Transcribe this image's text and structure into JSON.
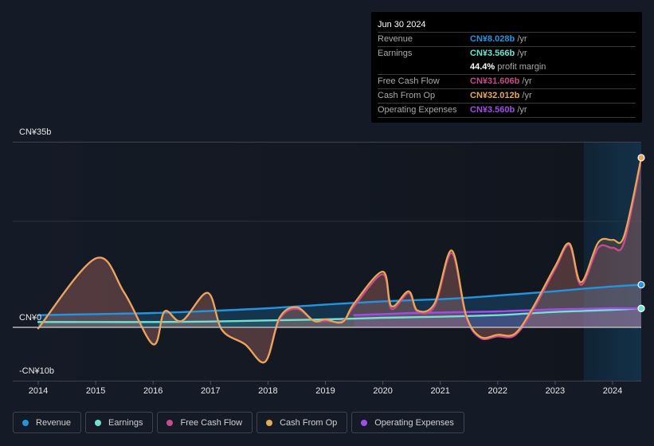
{
  "tooltip": {
    "date": "Jun 30 2024",
    "rows": [
      {
        "label": "Revenue",
        "value": "CN¥8.028b",
        "unit": " /yr",
        "color": "#2394df"
      },
      {
        "label": "Earnings",
        "value": "CN¥3.566b",
        "unit": " /yr",
        "color": "#6fe3d0"
      },
      {
        "label": "",
        "value": "44.4%",
        "unit": " profit margin",
        "color": "#ffffff"
      },
      {
        "label": "Free Cash Flow",
        "value": "CN¥31.606b",
        "unit": " /yr",
        "color": "#c84b8b"
      },
      {
        "label": "Cash From Op",
        "value": "CN¥32.012b",
        "unit": " /yr",
        "color": "#e8a956"
      },
      {
        "label": "Operating Expenses",
        "value": "CN¥3.560b",
        "unit": " /yr",
        "color": "#a24de8"
      }
    ]
  },
  "legend": [
    {
      "label": "Revenue",
      "color": "#2394df"
    },
    {
      "label": "Earnings",
      "color": "#6fe3d0"
    },
    {
      "label": "Free Cash Flow",
      "color": "#c84b8b"
    },
    {
      "label": "Cash From Op",
      "color": "#e8a956"
    },
    {
      "label": "Operating Expenses",
      "color": "#a24de8"
    }
  ],
  "chart_data": {
    "type": "line",
    "title": "",
    "xlabel": "",
    "ylabel": "",
    "y_tick_labels": [
      "CN¥35b",
      "CN¥0",
      "-CN¥10b"
    ],
    "y_ticks": [
      35,
      0,
      -10
    ],
    "ylim": [
      -10,
      35
    ],
    "x_tick_labels": [
      "2014",
      "2015",
      "2016",
      "2017",
      "2018",
      "2019",
      "2020",
      "2021",
      "2022",
      "2023",
      "2024"
    ],
    "xlim": [
      2013.85,
      2024.5
    ],
    "grid": true,
    "legend_position": "bottom",
    "highlight_range": [
      2023.5,
      2024.5
    ],
    "series": [
      {
        "name": "Revenue",
        "color": "#2394df",
        "x": [
          2014.0,
          2015.0,
          2016.0,
          2017.0,
          2018.0,
          2019.0,
          2020.0,
          2021.0,
          2021.5,
          2022.0,
          2022.5,
          2023.0,
          2023.5,
          2024.0,
          2024.5
        ],
        "values": [
          2.3,
          2.5,
          2.7,
          3.1,
          3.6,
          4.3,
          4.9,
          5.3,
          5.6,
          6.0,
          6.4,
          6.8,
          7.3,
          7.7,
          8.03
        ]
      },
      {
        "name": "Earnings",
        "color": "#6fe3d0",
        "x": [
          2014.0,
          2015.0,
          2016.0,
          2017.0,
          2018.0,
          2019.0,
          2020.0,
          2021.0,
          2022.0,
          2022.5,
          2023.0,
          2023.5,
          2024.0,
          2024.5
        ],
        "values": [
          1.0,
          1.0,
          1.0,
          1.1,
          1.3,
          1.5,
          1.8,
          2.0,
          2.3,
          2.6,
          2.9,
          3.1,
          3.3,
          3.57
        ]
      },
      {
        "name": "Free Cash Flow",
        "color": "#c84b8b",
        "x": [
          2014.0,
          2015.0,
          2015.5,
          2016.0,
          2016.2,
          2016.5,
          2016.95,
          2017.2,
          2017.6,
          2017.95,
          2018.2,
          2018.5,
          2018.8,
          2019.0,
          2019.3,
          2019.5,
          2020.0,
          2020.15,
          2020.45,
          2020.6,
          2020.9,
          2021.2,
          2021.45,
          2021.7,
          2022.0,
          2022.3,
          2022.6,
          2023.0,
          2023.25,
          2023.45,
          2023.75,
          2024.0,
          2024.2,
          2024.5
        ],
        "values": [
          -0.2,
          13.0,
          6.5,
          -3.2,
          3.0,
          1.2,
          6.5,
          -0.5,
          -3.2,
          -6.5,
          1.5,
          3.5,
          1.2,
          1.2,
          1.2,
          4.0,
          10.0,
          3.5,
          6.5,
          3.0,
          4.0,
          14.0,
          2.0,
          -2.0,
          -1.7,
          -1.5,
          3.0,
          11.0,
          15.5,
          8.0,
          15.0,
          15.0,
          16.0,
          31.6
        ]
      },
      {
        "name": "Cash From Op",
        "color": "#e8a956",
        "x": [
          2014.0,
          2015.0,
          2015.5,
          2016.0,
          2016.2,
          2016.5,
          2016.95,
          2017.2,
          2017.6,
          2017.95,
          2018.2,
          2018.5,
          2018.8,
          2019.0,
          2019.3,
          2019.5,
          2020.0,
          2020.15,
          2020.45,
          2020.6,
          2020.9,
          2021.2,
          2021.45,
          2021.7,
          2022.0,
          2022.3,
          2022.6,
          2023.0,
          2023.25,
          2023.45,
          2023.75,
          2024.0,
          2024.2,
          2024.5
        ],
        "values": [
          -0.2,
          13.0,
          6.5,
          -3.2,
          3.0,
          1.2,
          6.5,
          -0.5,
          -3.2,
          -6.5,
          1.8,
          3.8,
          1.2,
          1.5,
          1.0,
          4.5,
          10.5,
          4.0,
          6.8,
          3.2,
          4.5,
          14.5,
          2.3,
          -1.8,
          -1.4,
          -1.2,
          3.5,
          11.5,
          15.8,
          8.5,
          16.0,
          16.5,
          17.2,
          32.0
        ]
      },
      {
        "name": "Operating Expenses",
        "color": "#a24de8",
        "x": [
          2019.5,
          2020.0,
          2020.5,
          2021.0,
          2021.5,
          2022.0,
          2022.5,
          2023.0,
          2023.5,
          2024.0,
          2024.5
        ],
        "values": [
          2.3,
          2.5,
          2.7,
          2.8,
          2.9,
          3.0,
          3.2,
          3.4,
          3.5,
          3.6,
          3.56
        ]
      }
    ]
  }
}
